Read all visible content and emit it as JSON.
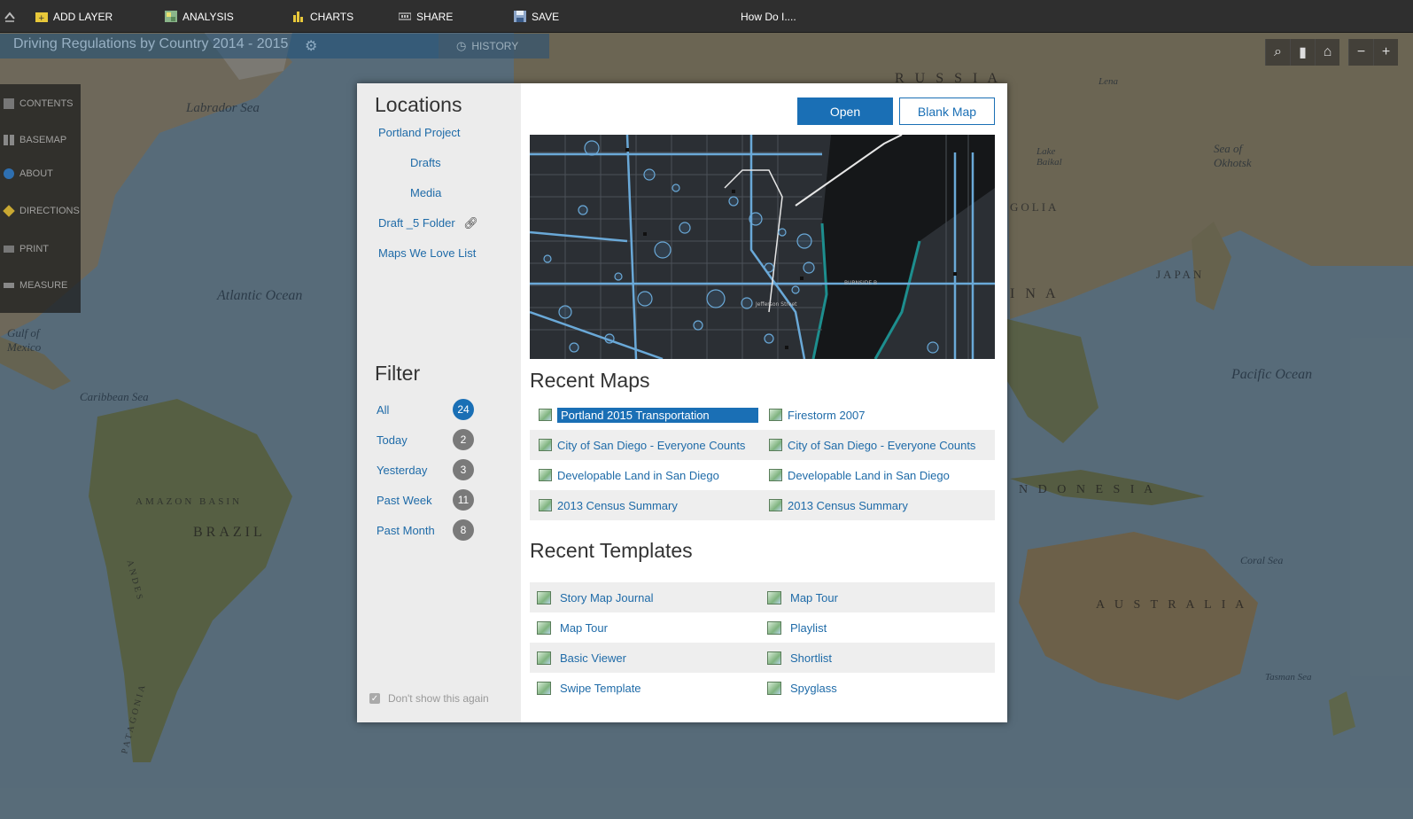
{
  "toolbar": {
    "add_layer": "ADD LAYER",
    "analysis": "ANALYSIS",
    "charts": "CHARTS",
    "share": "SHARE",
    "save": "SAVE",
    "how_do_i": "How Do I...."
  },
  "app": {
    "title": "Driving Regulations by Country 2014 - 2015",
    "history": "HISTORY"
  },
  "sidebar": {
    "items": [
      {
        "label": "CONTENTS",
        "icon": "contents-icon"
      },
      {
        "label": "BASEMAP",
        "icon": "basemap-icon"
      },
      {
        "label": "ABOUT",
        "icon": "info-icon"
      },
      {
        "label": "DIRECTIONS",
        "icon": "directions-icon"
      },
      {
        "label": "PRINT",
        "icon": "print-icon"
      },
      {
        "label": "MEASURE",
        "icon": "measure-icon"
      }
    ]
  },
  "map_labels": {
    "labrador_sea": "Labrador Sea",
    "atlantic": "Atlantic Ocean",
    "gulf_mexico": "Gulf of Mexico",
    "caribbean": "Caribbean Sea",
    "amazon_basin": "AMAZON BASIN",
    "brazil": "BRAZIL",
    "russia": "R U S S I A",
    "sea_okhotsk": "Sea of Okhotsk",
    "lake_baikal": "Lake Baikal",
    "golia": "GOLIA",
    "japan": "JAPAN",
    "ina": "I N A",
    "pacific": "Pacific Ocean",
    "indonesia": "N D O N E S I A",
    "coral_sea": "Coral Sea",
    "australia": "A U S T R A L I A",
    "tasman_sea": "Tasman Sea",
    "andes": "ANDES",
    "patagonia": "PATAGONIA",
    "lena": "Lena"
  },
  "dialog": {
    "locations_title": "Locations",
    "locations": [
      "Portland Project",
      "Drafts",
      "Media",
      "Draft _5 Folder",
      "Maps We Love List"
    ],
    "filter_title": "Filter",
    "filters": [
      {
        "label": "All",
        "count": "24",
        "active": true
      },
      {
        "label": "Today",
        "count": "2"
      },
      {
        "label": "Yesterday",
        "count": "3"
      },
      {
        "label": "Past Week",
        "count": "11"
      },
      {
        "label": "Past Month",
        "count": "8"
      }
    ],
    "dont_show": "Don't show this again",
    "open_button": "Open",
    "blank_map_button": "Blank Map",
    "recent_maps_title": "Recent Maps",
    "recent_maps": [
      [
        "Portland 2015 Transportation",
        "Firestorm 2007"
      ],
      [
        "City of San Diego - Everyone Counts",
        "City of San Diego - Everyone Counts"
      ],
      [
        "Developable Land in San Diego",
        "Developable Land in San Diego"
      ],
      [
        "2013 Census Summary",
        "2013 Census Summary"
      ]
    ],
    "recent_templates_title": "Recent Templates",
    "recent_templates": [
      [
        "Story Map Journal",
        "Map Tour"
      ],
      [
        "Map Tour",
        "Playlist"
      ],
      [
        "Basic Viewer",
        "Shortlist"
      ],
      [
        "Swipe Template",
        "Spyglass"
      ]
    ],
    "preview_labels": {
      "jefferson": "Jefferson Street",
      "burnside": "BURNSIDE B"
    }
  },
  "colors": {
    "accent": "#1a6fb5",
    "link": "#1f6ba8",
    "toolbar": "#2f2f2f"
  }
}
